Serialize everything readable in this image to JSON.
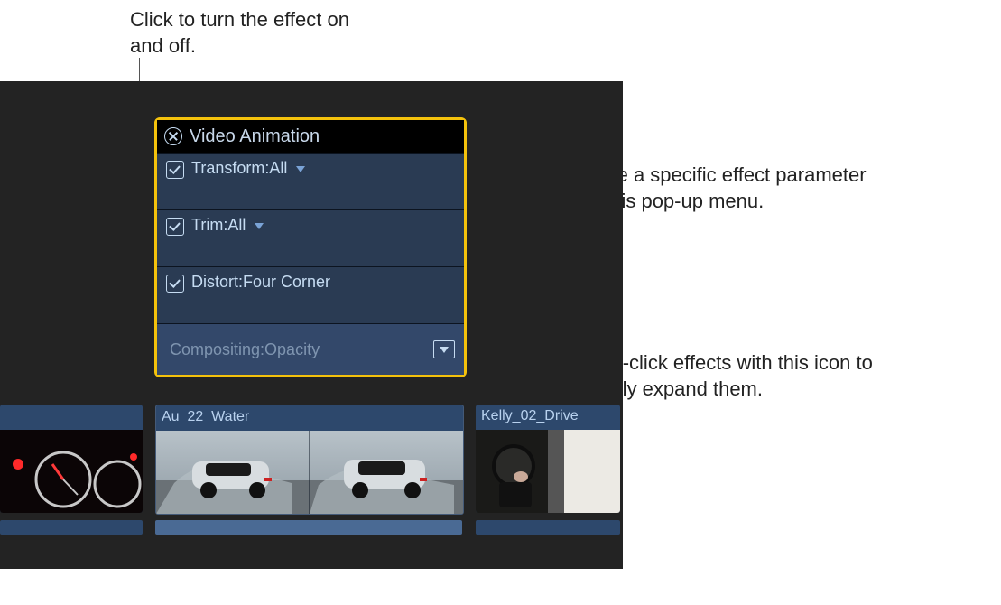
{
  "callouts": {
    "top": "Click to turn the effect on and off.",
    "right1": "Choose a specific effect parameter from this pop-up menu.",
    "right2": "Double-click effects with this icon to vertically expand them."
  },
  "panel": {
    "title": "Video Animation",
    "effects": [
      {
        "label": "Transform:All",
        "checked": true,
        "dropdown": true
      },
      {
        "label": "Trim:All",
        "checked": true,
        "dropdown": true
      },
      {
        "label": "Distort:Four Corner",
        "checked": true,
        "dropdown": false
      },
      {
        "label": "Compositing:Opacity",
        "checked": false,
        "dropdown": false,
        "expandable": true
      }
    ]
  },
  "clips": [
    {
      "name": ""
    },
    {
      "name": "Au_22_Water"
    },
    {
      "name": "Kelly_02_Drive"
    }
  ]
}
